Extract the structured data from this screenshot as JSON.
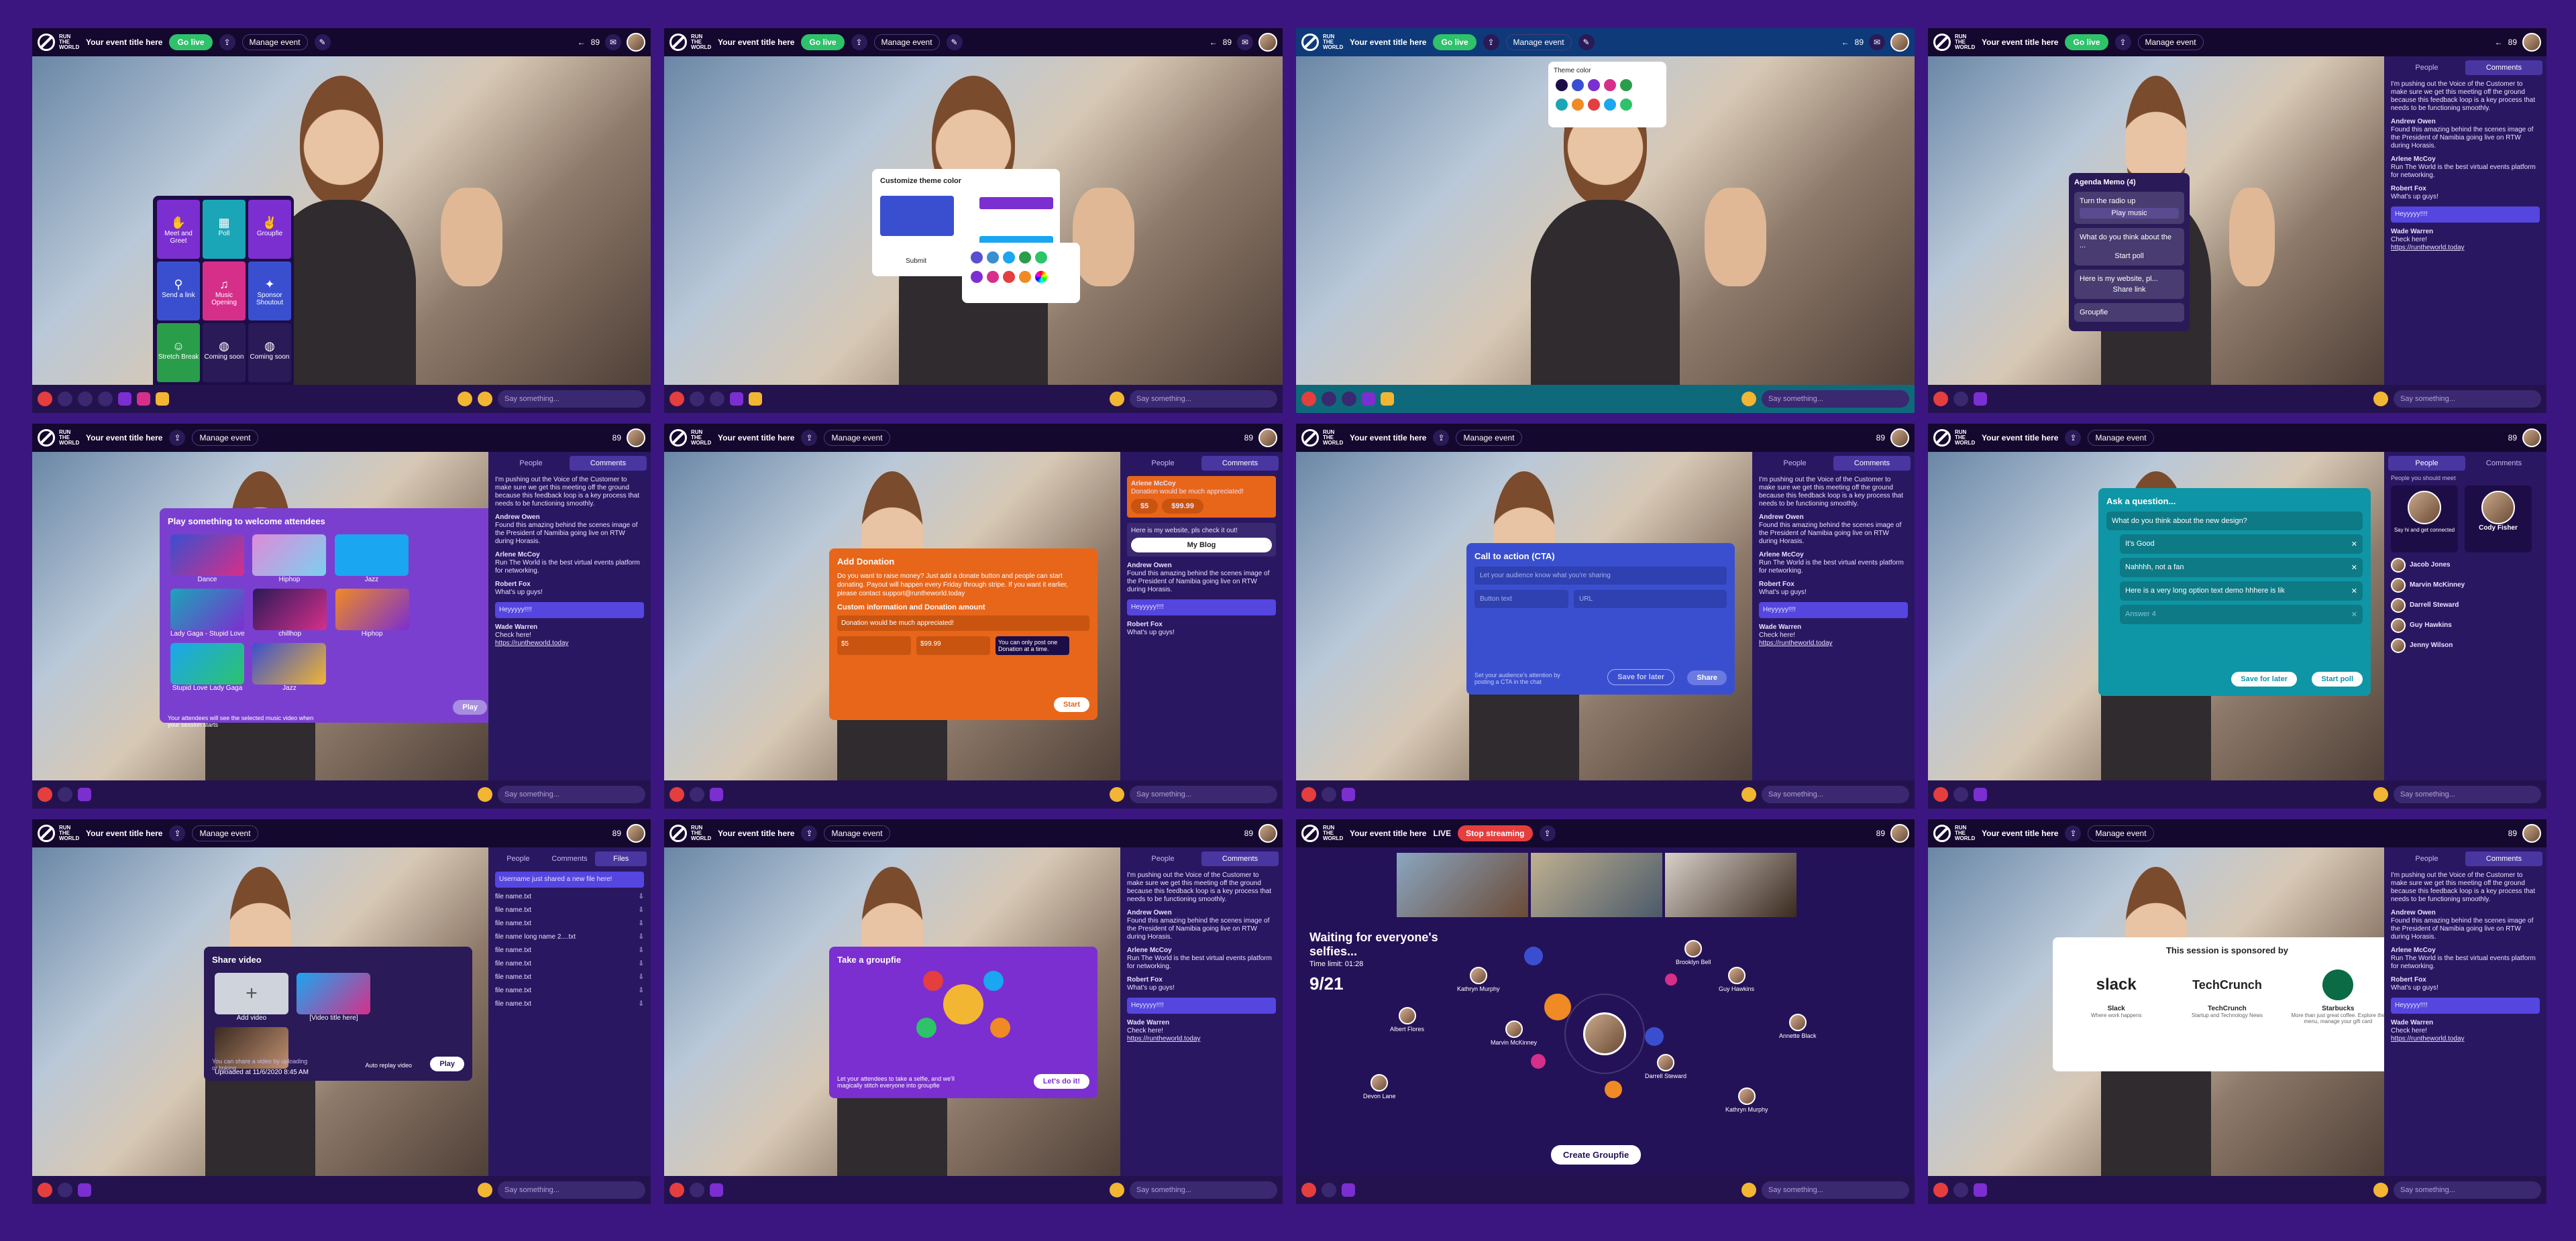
{
  "common": {
    "brand": "RUN THE WORLD",
    "event_title": "Your event title here",
    "go_live": "Go live",
    "manage_event": "Manage event",
    "count": "89",
    "say_placeholder": "Say something...",
    "tabs": [
      "People",
      "Comments"
    ],
    "tabs_files": [
      "People",
      "Comments",
      "Files"
    ]
  },
  "chat": [
    {
      "name": "",
      "text": "I'm pushing out the Voice of the Customer to make sure we get this meeting off the ground because this feedback loop is a key process that needs to be functioning smoothly."
    },
    {
      "name": "Andrew Owen",
      "text": "Found this amazing behind the scenes image of the President of Namibia going live on RTW during Horasis."
    },
    {
      "name": "Arlene McCoy",
      "text": "Run The World is the best virtual events platform for networking."
    },
    {
      "name": "Robert Fox",
      "text": "What's up guys!"
    },
    {
      "name": "",
      "text": "Heyyyyy!!!!"
    },
    {
      "name": "Wade Warren",
      "text": "Check here!",
      "link": "https://runtheworld.today"
    }
  ],
  "p1": {
    "apps": [
      {
        "label": "Meet and Greet",
        "color": "#7b2fd0"
      },
      {
        "label": "Poll",
        "color": "#1aa6b7"
      },
      {
        "label": "Groupfie",
        "color": "#7b2fd0"
      },
      {
        "label": "Send a link",
        "color": "#3a4fd0"
      },
      {
        "label": "Music Opening",
        "color": "#d62f8a"
      },
      {
        "label": "Sponsor Shoutout",
        "color": "#3a4fd0"
      },
      {
        "label": "Stretch Break",
        "color": "#2a9d4a"
      },
      {
        "label": "Coming soon",
        "color": "#2a1a58"
      },
      {
        "label": "Coming soon",
        "color": "#2a1a58"
      }
    ]
  },
  "p2": {
    "title": "Customize theme color",
    "submit": "Submit"
  },
  "p3": {
    "title": "Theme color"
  },
  "p4": {
    "title": "Agenda Memo (4)",
    "items": [
      {
        "text": "Turn the radio up",
        "action": "Play music"
      },
      {
        "text": "What do you think about the ...",
        "action": "Start poll"
      },
      {
        "text": "Here is my website, pl...",
        "action": "Share link"
      },
      {
        "text": "Groupfie",
        "action": ""
      }
    ]
  },
  "p5": {
    "title": "Play something to welcome attendees",
    "tracks": [
      "Dance",
      "Hiphop",
      "Jazz",
      "Lady Gaga - Stupid Love",
      "chillhop",
      "Hiphop",
      "Stupid Love Lady Gaga",
      "Jazz"
    ],
    "note": "Your attendees will see the selected music video when your session starts",
    "play": "Play"
  },
  "p6": {
    "title": "Add Donation",
    "desc": "Do you want to raise money? Just add a donate button and people can start donating. Payout will happen every Friday through stripe. If you want it earlier, please contact support@runtheworld.today",
    "section": "Custom information and Donation amount",
    "message": "Donation would be much appreciated!",
    "amount1": "$5",
    "amount2": "$99.99",
    "tooltip": "You can only post one Donation at a time.",
    "start": "Start",
    "side_title": "Arlene McCoy",
    "side_msg": "Donation would be much appreciated!",
    "side_btn1": "$5",
    "side_btn2": "$99.99",
    "side_msg2": "Here is my website, pls check it out!",
    "side_btn3": "My Blog"
  },
  "p7": {
    "title": "Call to action (CTA)",
    "ph_text": "Let your audience know what you're sharing",
    "ph_button": "Button text",
    "ph_url": "URL",
    "note": "Set your audience's attention by posting a CTA in the chat",
    "save": "Save for later",
    "share": "Share"
  },
  "p8": {
    "title": "Ask a question...",
    "question": "What do you think about the new design?",
    "answers": [
      "It's Good",
      "Nahhhh, not a fan",
      "Here is a very long option text demo hhhere is lik",
      "Answer 4"
    ],
    "save": "Save for later",
    "start": "Start poll",
    "people_label": "People you should meet",
    "tooltip": "Say hi and get connected",
    "cards": [
      "",
      "Cody Fisher"
    ],
    "people": [
      "Jacob Jones",
      "Marvin McKinney",
      "Darrell Steward",
      "Guy Hawkins",
      "Jenny Wilson"
    ]
  },
  "p9": {
    "title": "Share video",
    "add": "Add video",
    "v1": "[Video title here]",
    "v2": "Uploaded at 11/6/2020 8:45 AM",
    "note": "You can share a video by uploading or linking",
    "auto": "Auto replay video",
    "play": "Play",
    "notice": "Username just shared a new file here!",
    "files": [
      "file name.txt",
      "file name.txt",
      "file name.txt",
      "file name long name 2....txt",
      "file name.txt",
      "file name.txt",
      "file name.txt",
      "file name.txt",
      "file name.txt"
    ]
  },
  "p10": {
    "title": "Take a groupfie",
    "note": "Let your attendees to take a selfie, and we'll magically stitch everyone into groupfie",
    "cta": "Let's do it!"
  },
  "p11": {
    "live": "LIVE",
    "stop": "Stop streaming",
    "waiting": "Waiting for everyone's selfies...",
    "time": "Time limit: 01:28",
    "count": "9/21",
    "names": [
      "Brooklyn Bell",
      "Kathryn Murphy",
      "Guy Hawkins",
      "Albert Flores",
      "Marvin McKinney",
      "Annette Black",
      "Darrell Steward",
      "Devon Lane",
      "Kathryn Murphy"
    ],
    "cta": "Create Groupfie"
  },
  "p12": {
    "title": "This session is sponsored by",
    "sponsors": [
      {
        "name": "Slack",
        "desc": "Where work happens"
      },
      {
        "name": "TechCrunch",
        "desc": "Startup and Technology News"
      },
      {
        "name": "Starbucks",
        "desc": "More than just great coffee. Explore the menu, manage your gift card"
      }
    ]
  }
}
